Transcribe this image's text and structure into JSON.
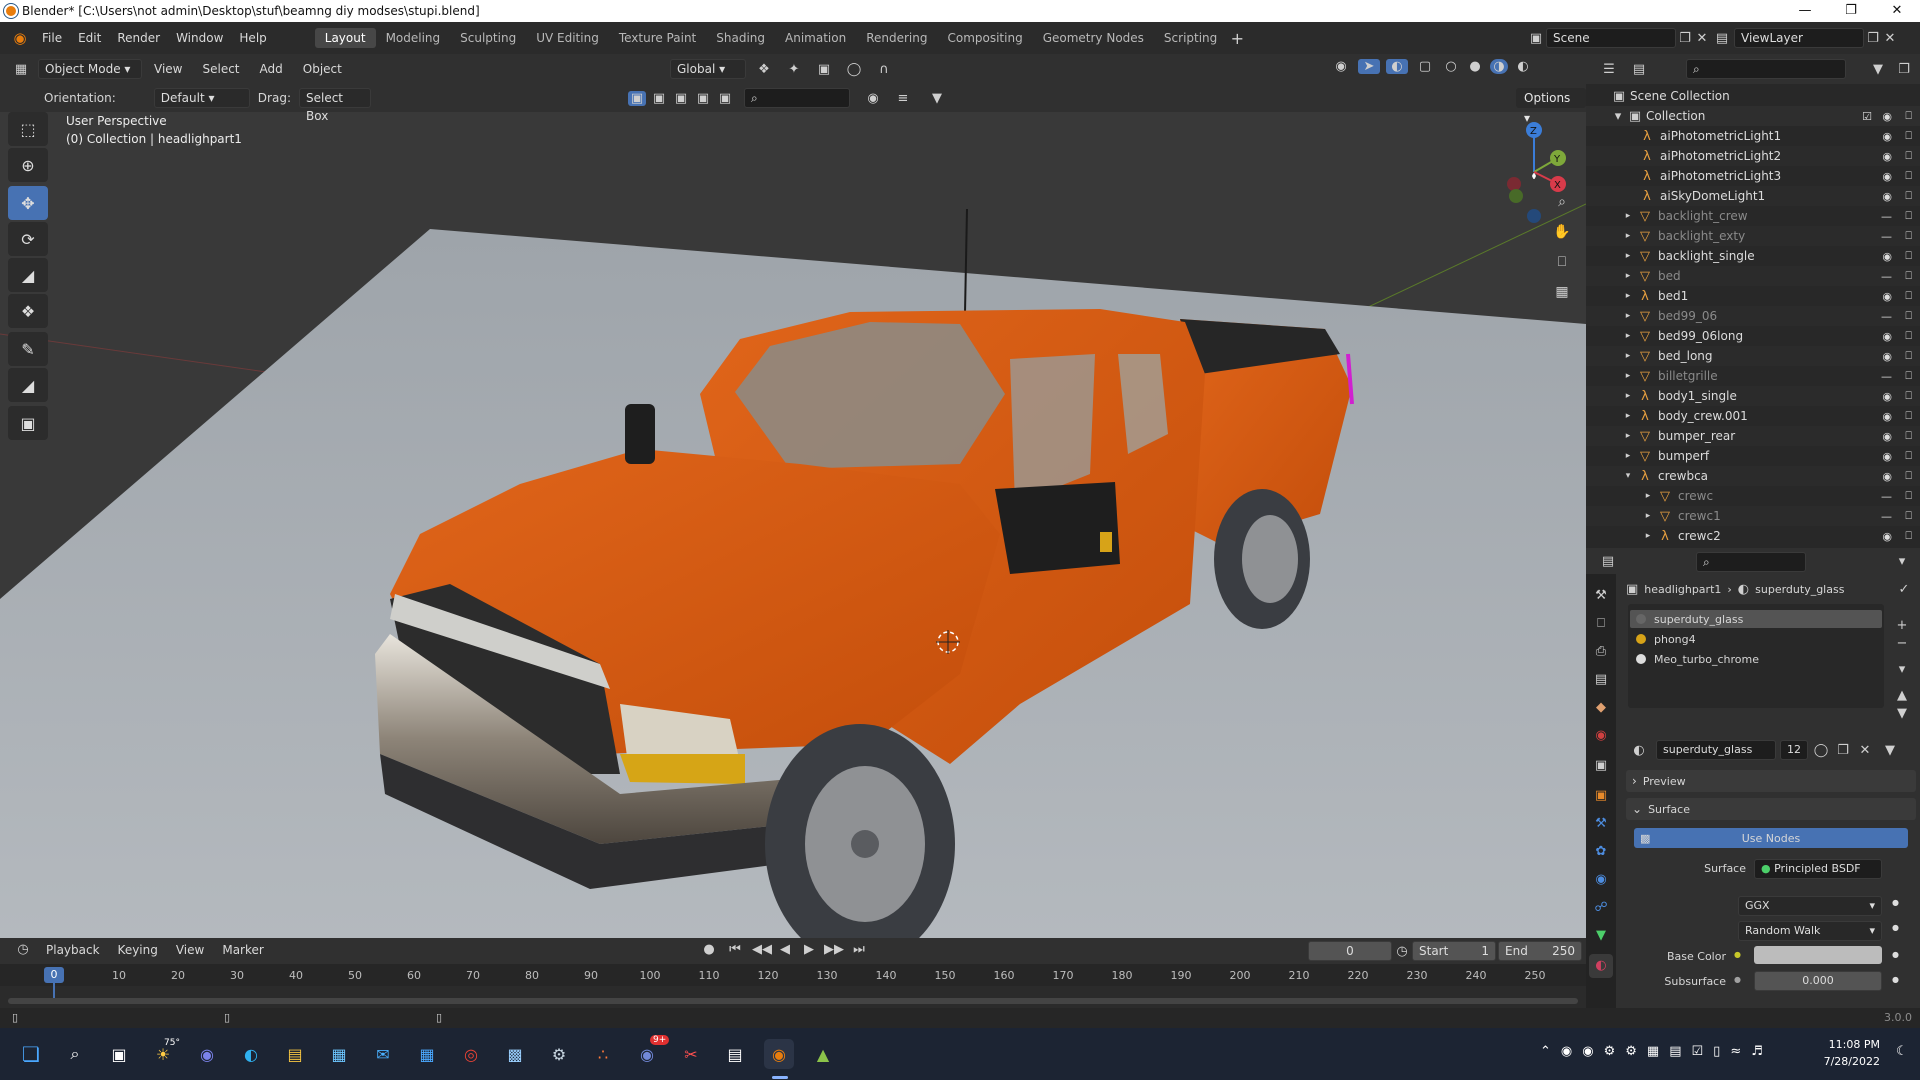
{
  "window": {
    "title": "Blender* [C:\\Users\\not admin\\Desktop\\stuf\\beamng diy modses\\stupi.blend]"
  },
  "menu": [
    "File",
    "Edit",
    "Render",
    "Window",
    "Help"
  ],
  "workspaces": [
    "Layout",
    "Modeling",
    "Sculpting",
    "UV Editing",
    "Texture Paint",
    "Shading",
    "Animation",
    "Rendering",
    "Compositing",
    "Geometry Nodes",
    "Scripting"
  ],
  "scene": {
    "name": "Scene",
    "view_layer": "ViewLayer"
  },
  "viewport": {
    "mode": "Object Mode",
    "menus": [
      "View",
      "Select",
      "Add",
      "Object"
    ],
    "transform": "Global",
    "orientation_label": "Orientation:",
    "orientation_value": "Default",
    "drag_label": "Drag:",
    "drag_value": "Select Box",
    "options": "Options",
    "overlay_line1": "User Perspective",
    "overlay_line2": "(0) Collection | headlighpart1"
  },
  "gizmo": {
    "x": "X",
    "y": "Y",
    "z": "Z"
  },
  "outliner": {
    "root": "Scene Collection",
    "collection": "Collection",
    "items": [
      {
        "name": "aiPhotometricLight1",
        "dim": false
      },
      {
        "name": "aiPhotometricLight2",
        "dim": false
      },
      {
        "name": "aiPhotometricLight3",
        "dim": false
      },
      {
        "name": "aiSkyDomeLight1",
        "dim": false
      },
      {
        "name": "backlight_crew",
        "dim": true
      },
      {
        "name": "backlight_exty",
        "dim": true
      },
      {
        "name": "backlight_single",
        "dim": false
      },
      {
        "name": "bed",
        "dim": true
      },
      {
        "name": "bed1",
        "dim": false
      },
      {
        "name": "bed99_06",
        "dim": true
      },
      {
        "name": "bed99_06long",
        "dim": false
      },
      {
        "name": "bed_long",
        "dim": false
      },
      {
        "name": "billetgrille",
        "dim": true
      },
      {
        "name": "body1_single",
        "dim": false
      },
      {
        "name": "body_crew.001",
        "dim": false
      },
      {
        "name": "bumper_rear",
        "dim": false
      },
      {
        "name": "bumperf",
        "dim": false
      },
      {
        "name": "crewbca",
        "dim": false
      },
      {
        "name": "crewc",
        "dim": true
      },
      {
        "name": "crewc1",
        "dim": true
      },
      {
        "name": "crewc2",
        "dim": false
      }
    ]
  },
  "properties": {
    "breadcrumb_object": "headlighpart1",
    "breadcrumb_material": "superduty_glass",
    "slots": [
      "superduty_glass",
      "phong4",
      "Meo_turbo_chrome"
    ],
    "material_name": "superduty_glass",
    "users": "12",
    "preview": "Preview",
    "surface_panel": "Surface",
    "use_nodes": "Use Nodes",
    "surface_label": "Surface",
    "surface_value": "Principled BSDF",
    "distribution": "GGX",
    "subsurface_method": "Random Walk",
    "base_color_label": "Base Color",
    "subsurface_label": "Subsurface",
    "subsurface_value": "0.000"
  },
  "timeline": {
    "menus": [
      "Playback",
      "Keying",
      "View",
      "Marker"
    ],
    "current_frame": "0",
    "start_label": "Start",
    "start": "1",
    "end_label": "End",
    "end": "250",
    "ticks": [
      "0",
      "10",
      "20",
      "30",
      "40",
      "50",
      "60",
      "70",
      "80",
      "90",
      "100",
      "110",
      "120",
      "130",
      "140",
      "150",
      "160",
      "170",
      "180",
      "190",
      "200",
      "210",
      "220",
      "230",
      "240",
      "250"
    ]
  },
  "status": {
    "version": "3.0.0"
  },
  "taskbar": {
    "weather": "75°",
    "badge": "9+",
    "time": "11:08 PM",
    "date": "7/28/2022"
  },
  "colors": {
    "accent": "#4772b3",
    "truck": "#d4570e",
    "blender_orange": "#e87d0d"
  }
}
